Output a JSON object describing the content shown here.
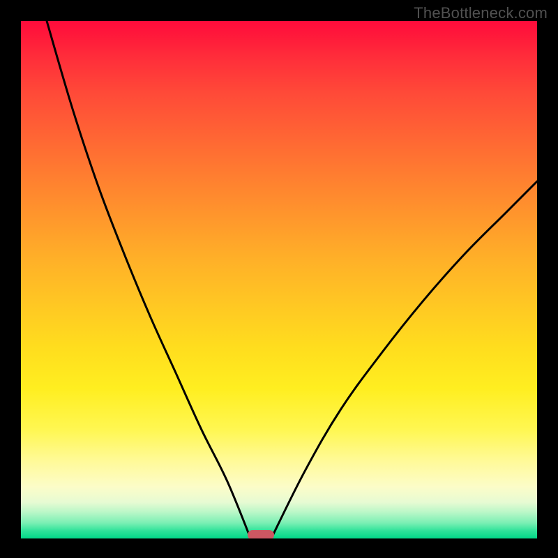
{
  "watermark": "TheBottleneck.com",
  "chart_data": {
    "type": "line",
    "title": "",
    "xlabel": "",
    "ylabel": "",
    "xlim": [
      0,
      100
    ],
    "ylim": [
      0,
      100
    ],
    "grid": false,
    "background": "rainbow-gradient (red top → green bottom)",
    "series": [
      {
        "name": "left-curve",
        "x": [
          5,
          10,
          15,
          20,
          25,
          30,
          35,
          40,
          44.5
        ],
        "values": [
          100,
          83,
          68,
          55,
          43,
          32,
          21,
          11,
          0
        ]
      },
      {
        "name": "right-curve",
        "x": [
          48.5,
          55,
          62,
          70,
          78,
          86,
          94,
          100
        ],
        "values": [
          0,
          13,
          25,
          36,
          46,
          55,
          63,
          69
        ]
      }
    ],
    "marker": {
      "x_center": 46.5,
      "color": "#cd5762",
      "shape": "rounded-bar"
    },
    "frame": {
      "outer_border_color": "#000000",
      "outer_border_width_px": 30
    }
  }
}
